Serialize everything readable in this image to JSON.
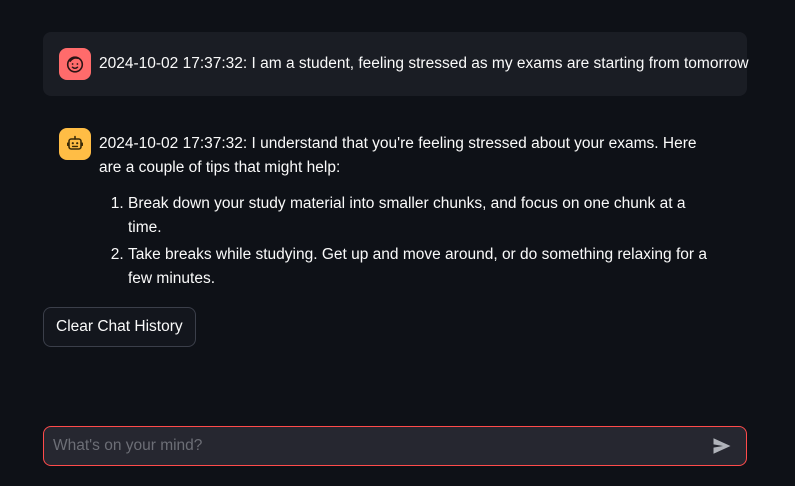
{
  "messages": [
    {
      "role": "user",
      "avatar_icon": "smiley-face-icon",
      "avatar_color": "#ff6b6b",
      "text": "2024-10-02 17:37:32: I am a student, feeling stressed as my exams are starting from tomorrow"
    },
    {
      "role": "assistant",
      "avatar_icon": "robot-icon",
      "avatar_color": "#ffbd45",
      "intro": "2024-10-02 17:37:32: I understand that you're feeling stressed about your exams. Here are a couple of tips that might help:",
      "list": [
        "Break down your study material into smaller chunks, and focus on one chunk at a time.",
        "Take breaks while studying. Get up and move around, or do something relaxing for a few minutes."
      ]
    }
  ],
  "clear_button_label": "Clear Chat History",
  "chat_input": {
    "placeholder": "What's on your mind?",
    "value": "",
    "send_icon": "send-icon",
    "border_color": "#ff4b4b"
  },
  "colors": {
    "background": "#0e1117",
    "user_bubble": "#1a1d24",
    "input_background": "#262730"
  }
}
